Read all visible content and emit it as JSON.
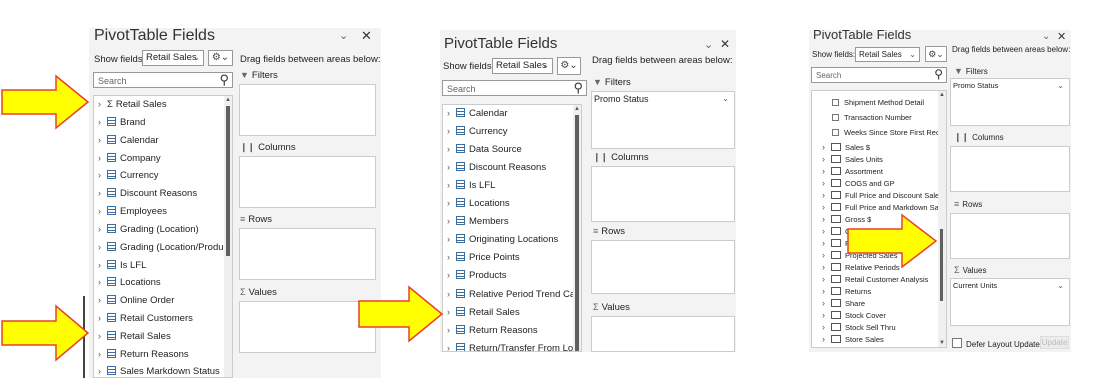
{
  "panel1": {
    "title": "PivotTable Fields",
    "show_fields_label": "Show fields:",
    "show_fields_value": "Retail Sales",
    "drag_text": "Drag fields between areas below:",
    "search_placeholder": "Search",
    "fields": [
      {
        "label": "Retail Sales",
        "kind": "sigma"
      },
      {
        "label": "Brand",
        "kind": "table"
      },
      {
        "label": "Calendar",
        "kind": "table"
      },
      {
        "label": "Company",
        "kind": "table"
      },
      {
        "label": "Currency",
        "kind": "table"
      },
      {
        "label": "Discount Reasons",
        "kind": "table"
      },
      {
        "label": "Employees",
        "kind": "table"
      },
      {
        "label": "Grading (Location)",
        "kind": "table"
      },
      {
        "label": "Grading (Location/Product)",
        "kind": "table"
      },
      {
        "label": "Is LFL",
        "kind": "table"
      },
      {
        "label": "Locations",
        "kind": "table"
      },
      {
        "label": "Online Order",
        "kind": "table"
      },
      {
        "label": "Retail Customers",
        "kind": "table"
      },
      {
        "label": "Retail Sales",
        "kind": "table"
      },
      {
        "label": "Return Reasons",
        "kind": "table"
      },
      {
        "label": "Sales Markdown Status",
        "kind": "table"
      }
    ],
    "areas": {
      "filters": "Filters",
      "columns": "Columns",
      "rows": "Rows",
      "values": "Values"
    }
  },
  "panel2": {
    "title": "PivotTable Fields",
    "show_fields_label": "Show fields:",
    "show_fields_value": "Retail Sales",
    "drag_text": "Drag fields between areas below:",
    "search_placeholder": "Search",
    "fields": [
      "Calendar",
      "Currency",
      "Data Source",
      "Discount Reasons",
      "Is LFL",
      "Locations",
      "Members",
      "Originating Locations",
      "Price Points",
      "Products",
      "Relative Period Trend Calen...",
      "Retail Sales",
      "Return Reasons",
      "Return/Transfer From Locati..."
    ],
    "filters_chip": "Promo Status",
    "areas": {
      "filters": "Filters",
      "columns": "Columns",
      "rows": "Rows",
      "values": "Values"
    }
  },
  "panel3": {
    "title": "PivotTable Fields",
    "show_fields_label": "Show fields:",
    "show_fields_value": "Retail Sales",
    "drag_text": "Drag fields between areas below:",
    "search_placeholder": "Search",
    "fields": [
      {
        "label": "Shipment Method Detail",
        "kind": "checkbox"
      },
      {
        "label": "Transaction Number",
        "kind": "checkbox"
      },
      {
        "label": "Weeks Since Store First Recei...",
        "kind": "checkbox"
      },
      {
        "label": "Sales $",
        "kind": "folder"
      },
      {
        "label": "Sales Units",
        "kind": "folder"
      },
      {
        "label": "Assortment",
        "kind": "folder"
      },
      {
        "label": "COGS and GP",
        "kind": "folder"
      },
      {
        "label": "Full Price and Discount Sales",
        "kind": "folder"
      },
      {
        "label": "Full Price and Markdown Sa...",
        "kind": "folder"
      },
      {
        "label": "Gross $",
        "kind": "folder"
      },
      {
        "label": "G",
        "kind": "folder"
      },
      {
        "label": "F",
        "kind": "folder"
      },
      {
        "label": "Projected Sales",
        "kind": "folder"
      },
      {
        "label": "Relative Periods",
        "kind": "folder"
      },
      {
        "label": "Retail Customer Analysis",
        "kind": "folder"
      },
      {
        "label": "Returns",
        "kind": "folder"
      },
      {
        "label": "Share",
        "kind": "folder"
      },
      {
        "label": "Stock Cover",
        "kind": "folder"
      },
      {
        "label": "Stock Sell Thru",
        "kind": "folder"
      },
      {
        "label": "Store Sales",
        "kind": "folder"
      }
    ],
    "filters_chip": "Promo Status",
    "values_chip": "Current Units",
    "defer_label": "Defer Layout Update",
    "update_label": "Update",
    "areas": {
      "filters": "Filters",
      "columns": "Columns",
      "rows": "Rows",
      "values": "Values"
    }
  },
  "icons": {
    "close": "close-icon",
    "collapse": "chevron-down-icon",
    "gear": "gear-icon",
    "search": "search-icon"
  },
  "colors": {
    "arrow_fill": "#ffff00",
    "arrow_stroke": "#e8412a",
    "panel_bg": "#f3f3f3"
  }
}
